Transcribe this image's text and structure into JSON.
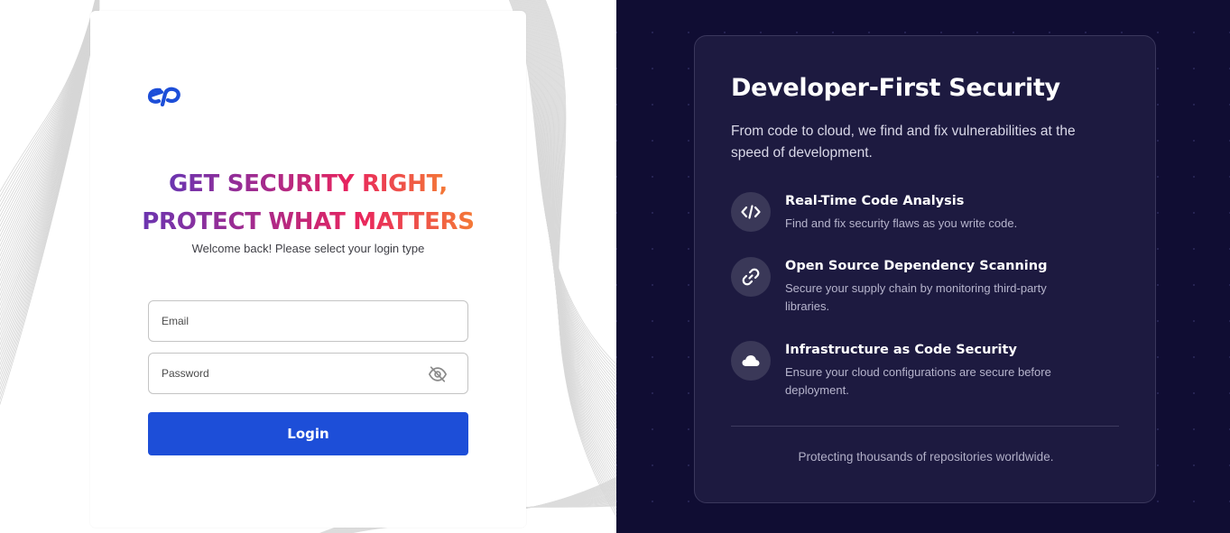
{
  "login": {
    "headline_line1": "GET SECURITY RIGHT,",
    "headline_line2": "PROTECT WHAT MATTERS",
    "subtitle": "Welcome back! Please select your login type",
    "email_placeholder": "Email",
    "password_placeholder": "Password",
    "login_button": "Login",
    "logo_icon": "ep-logo",
    "password_toggle_icon": "eye-off-icon",
    "accent_color": "#1d4ed8"
  },
  "promo": {
    "title": "Developer-First Security",
    "description": "From code to cloud, we find and fix vulnerabilities at the speed of development.",
    "features": [
      {
        "icon": "code-icon",
        "title": "Real-Time Code Analysis",
        "description": "Find and fix security flaws as you write code."
      },
      {
        "icon": "link-icon",
        "title": "Open Source Dependency Scanning",
        "description": "Secure your supply chain by monitoring third-party libraries."
      },
      {
        "icon": "cloud-icon",
        "title": "Infrastructure as Code Security",
        "description": "Ensure your cloud configurations are secure before deployment."
      }
    ],
    "footer": "Protecting thousands of repositories worldwide.",
    "background_color": "#100d33"
  }
}
